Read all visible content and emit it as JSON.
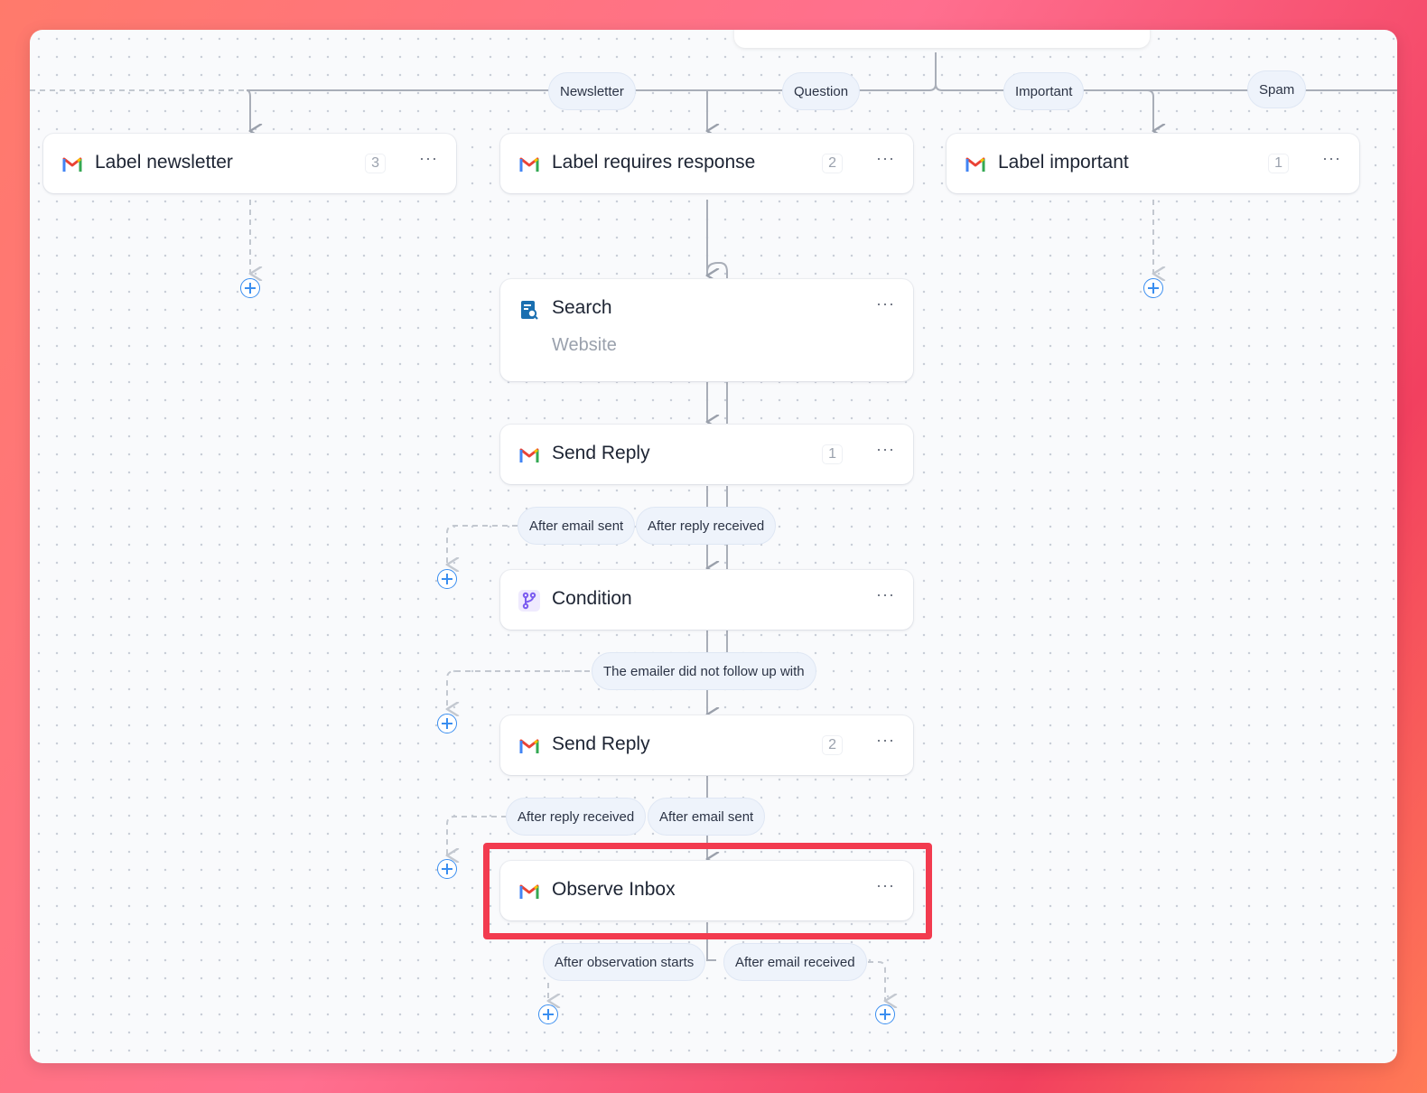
{
  "branches": {
    "newsletter": "Newsletter",
    "question": "Question",
    "important": "Important",
    "spam": "Spam"
  },
  "nodes": {
    "label_newsletter": {
      "title": "Label newsletter",
      "count": "3",
      "more": "···",
      "icon": "gmail-icon"
    },
    "label_requires_response": {
      "title": "Label requires response",
      "count": "2",
      "more": "···",
      "icon": "gmail-icon"
    },
    "label_important": {
      "title": "Label important",
      "count": "1",
      "more": "···",
      "icon": "gmail-icon"
    },
    "search": {
      "title": "Search",
      "subtitle": "Website",
      "more": "···",
      "icon": "search-website-icon"
    },
    "send_reply_1": {
      "title": "Send Reply",
      "count": "1",
      "more": "···",
      "icon": "gmail-icon"
    },
    "condition": {
      "title": "Condition",
      "more": "···",
      "icon": "condition-branch-icon"
    },
    "send_reply_2": {
      "title": "Send Reply",
      "count": "2",
      "more": "···",
      "icon": "gmail-icon"
    },
    "observe_inbox": {
      "title": "Observe Inbox",
      "more": "···",
      "icon": "gmail-icon"
    }
  },
  "edges": {
    "send_reply_1_after_email_sent": "After email sent",
    "send_reply_1_after_reply_received": "After reply received",
    "condition_not_follow_up": "The emailer did not follow up with",
    "send_reply_2_after_reply_received": "After reply received",
    "send_reply_2_after_email_sent": "After email sent",
    "observe_after_observation_starts": "After observation starts",
    "observe_after_email_received": "After email received"
  },
  "colors": {
    "highlight": "#f23b4f",
    "add_button": "#3a8ef0",
    "gmail_red": "#ea4335",
    "gmail_blue": "#4285f4",
    "gmail_green": "#34a853",
    "gmail_yellow": "#fbbc04",
    "condition_purple": "#7b5cf0"
  }
}
